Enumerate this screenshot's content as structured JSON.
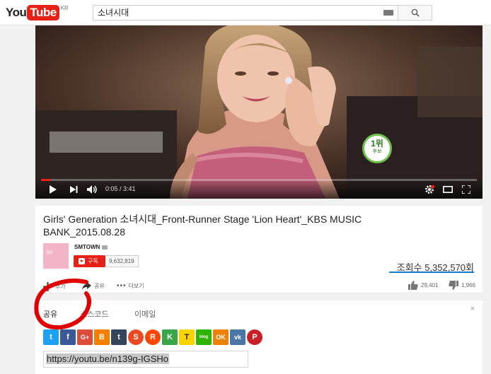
{
  "masthead": {
    "logo_you": "You",
    "logo_tube": "Tube",
    "logo_country": "KR",
    "search_value": "소녀시대"
  },
  "player": {
    "time": "0:05 / 3:41",
    "progress_fraction": 0.023,
    "badge_rank": "1위",
    "badge_sub": "후보"
  },
  "video": {
    "title": "Girls' Generation 소녀시대_Front-Runner Stage 'Lion Heart'_KBS MUSIC BANK_2015.08.28",
    "channel": "SMTOWN",
    "avatar_text": "SM",
    "subscribe_label": "구독",
    "subscriber_count": "9,632,819",
    "views": "조회수 5,352,570회",
    "like_fraction": 0.96,
    "actions": {
      "add": "추가",
      "share": "공유",
      "more": "더보기"
    },
    "likes": "29,401",
    "dislikes": "1,966"
  },
  "share": {
    "tabs": [
      "공유",
      "소스코드",
      "이메일"
    ],
    "close": "×",
    "url": "https://youtu.be/n139g-IGSHo",
    "services": [
      {
        "name": "twitter-icon",
        "glyph": "t",
        "color": "#1da1f2"
      },
      {
        "name": "facebook-icon",
        "glyph": "f",
        "color": "#3b5998"
      },
      {
        "name": "google-plus-icon",
        "glyph": "G+",
        "color": "#dd4b39"
      },
      {
        "name": "blogger-icon",
        "glyph": "B",
        "color": "#f57d00"
      },
      {
        "name": "tumblr-icon",
        "glyph": "t",
        "color": "#35465c"
      },
      {
        "name": "stumbleupon-icon",
        "glyph": "S",
        "color": "#eb4924"
      },
      {
        "name": "reddit-icon",
        "glyph": "R",
        "color": "#ff4500"
      },
      {
        "name": "kakao-story-icon",
        "glyph": "K",
        "color": "#3aa648"
      },
      {
        "name": "kakao-talk-icon",
        "glyph": "T",
        "color": "#f7d300"
      },
      {
        "name": "naver-blog-icon",
        "glyph": "blog",
        "color": "#2db400"
      },
      {
        "name": "odnoklassniki-icon",
        "glyph": "OK",
        "color": "#ee8208"
      },
      {
        "name": "vk-icon",
        "glyph": "vk",
        "color": "#4a76a8"
      },
      {
        "name": "pinterest-icon",
        "glyph": "P",
        "color": "#cb2027"
      }
    ]
  }
}
